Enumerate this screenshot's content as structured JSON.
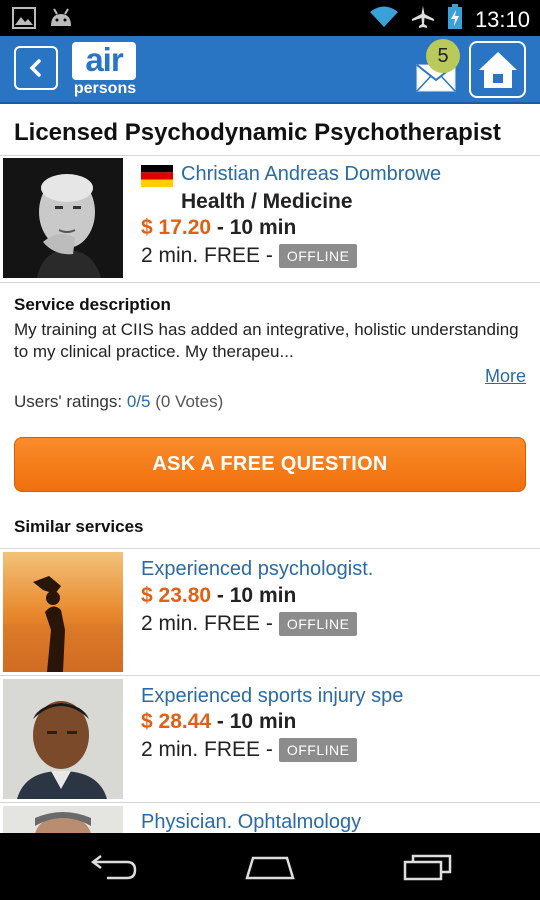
{
  "status_bar": {
    "time": "13:10",
    "icons": [
      "image-icon",
      "android-icon",
      "wifi-icon",
      "airplane-icon",
      "battery-charging-icon"
    ]
  },
  "app_bar": {
    "logo_top": "air",
    "logo_bottom": "persons",
    "message_count": "5",
    "colors": {
      "bar": "#2a74c4",
      "badge": "#b9c95a"
    }
  },
  "page_title": "Licensed Psychodynamic Psychotherapist",
  "expert": {
    "name": "Christian Andreas Dombrowe",
    "flag": "germany-flag",
    "category": "Health / Medicine",
    "price": "$ 17.20",
    "duration": "- 10 min",
    "free_text": "2 min. FREE -",
    "status": "OFFLINE"
  },
  "description": {
    "label": "Service description",
    "text": "My training at CIIS has added an integrative, holistic understanding to my clinical practice. My therapeu...",
    "more": "More",
    "ratings_label": "Users' ratings:",
    "ratings_value": "0/5",
    "ratings_votes": "(0 Votes)"
  },
  "ask_button": "ASK A FREE QUESTION",
  "similar": {
    "label": "Similar services",
    "items": [
      {
        "title": "Experienced psychologist.",
        "price": "$ 23.80",
        "duration": "- 10 min",
        "free_text": "2 min. FREE -",
        "status": "OFFLINE"
      },
      {
        "title": "Experienced sports injury spe",
        "price": "$ 28.44",
        "duration": "- 10 min",
        "free_text": "2 min. FREE -",
        "status": "OFFLINE"
      },
      {
        "title": "Physician. Ophtalmology"
      }
    ]
  },
  "colors": {
    "price": "#e06016",
    "link": "#2a6aa6",
    "button": "#f57a16",
    "offline_badge": "#8c8c8c"
  }
}
